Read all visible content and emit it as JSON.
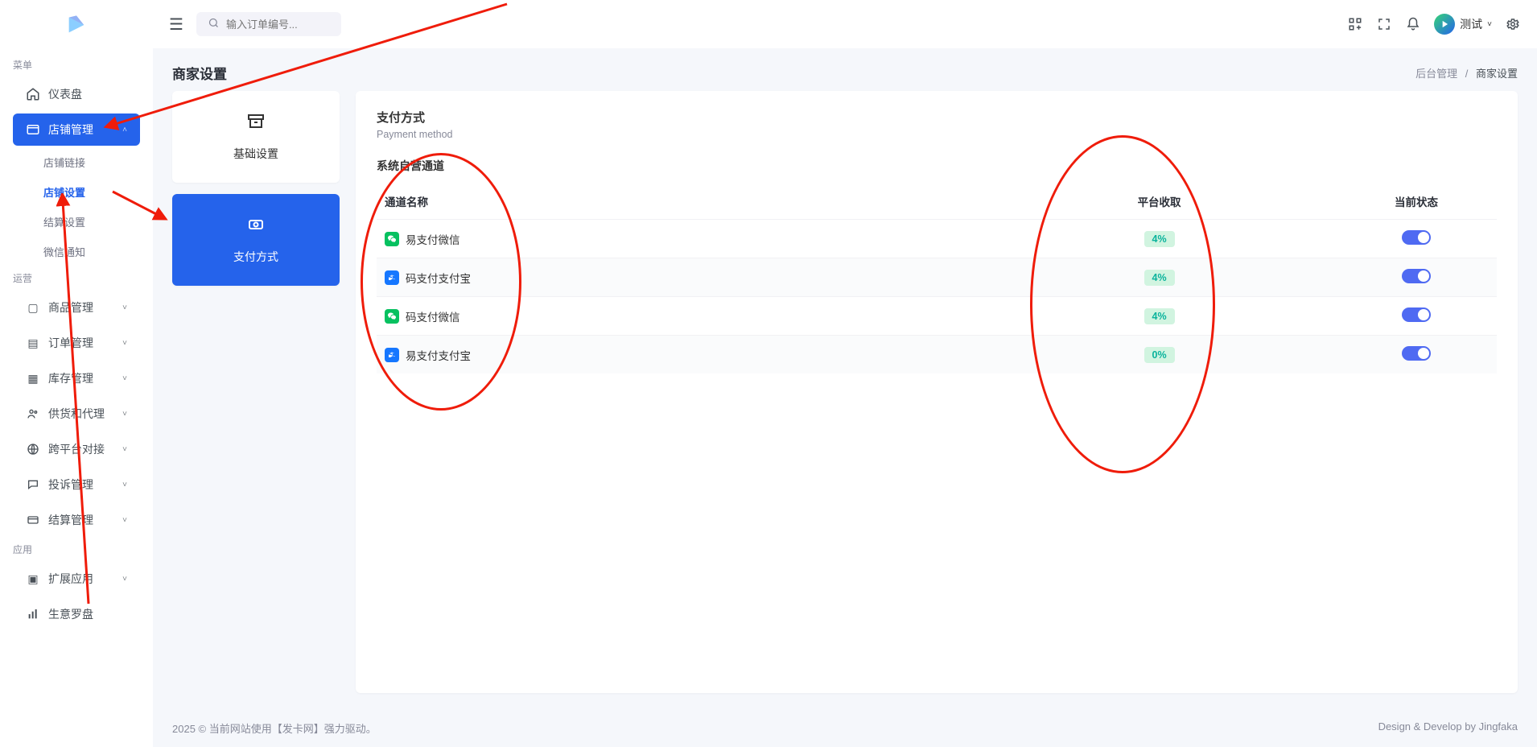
{
  "sidebar": {
    "section_menu": "菜单",
    "section_ops": "运营",
    "section_app": "应用",
    "dashboard": "仪表盘",
    "store_mgmt": "店铺管理",
    "sub": {
      "store_link": "店铺链接",
      "store_settings": "店铺设置",
      "settlement_settings": "结算设置",
      "wechat_notify": "微信通知"
    },
    "goods_mgmt": "商品管理",
    "order_mgmt": "订单管理",
    "stock_mgmt": "库存管理",
    "supply_agent": "供货和代理",
    "cross_platform": "跨平台对接",
    "complaint_mgmt": "投诉管理",
    "settlement_mgmt": "结算管理",
    "ext_apps": "扩展应用",
    "biz_compass": "生意罗盘"
  },
  "topbar": {
    "search_placeholder": "输入订单编号...",
    "user_name": "测试"
  },
  "page": {
    "title": "商家设置",
    "crumb_root": "后台管理",
    "crumb_current": "商家设置"
  },
  "side_tabs": {
    "basic": "基础设置",
    "payment": "支付方式"
  },
  "panel": {
    "title": "支付方式",
    "subtitle": "Payment method",
    "group": "系统自营通道",
    "columns": {
      "name": "通道名称",
      "fee": "平台收取",
      "status": "当前状态"
    },
    "rows": [
      {
        "name": "易支付微信",
        "icon": "wechat",
        "fee": "4%",
        "on": true
      },
      {
        "name": "码支付支付宝",
        "icon": "alipay",
        "fee": "4%",
        "on": true
      },
      {
        "name": "码支付微信",
        "icon": "wechat",
        "fee": "4%",
        "on": true
      },
      {
        "name": "易支付支付宝",
        "icon": "alipay",
        "fee": "0%",
        "on": true
      }
    ]
  },
  "footer": {
    "left": "2025 © 当前网站使用【发卡网】强力驱动。",
    "right": "Design & Develop by Jingfaka"
  }
}
